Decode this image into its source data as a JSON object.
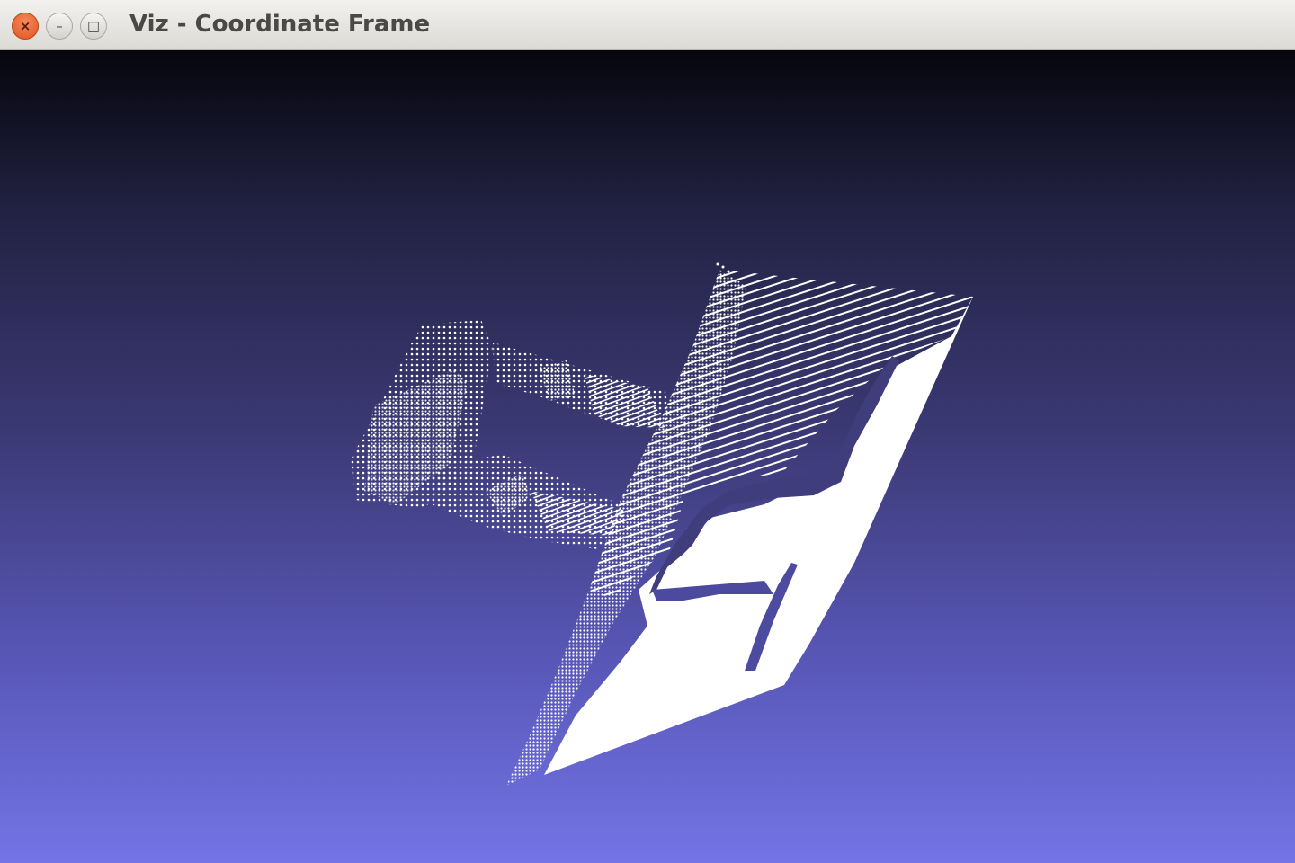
{
  "window": {
    "title": "Viz - Coordinate Frame",
    "buttons": {
      "close_glyph": "×",
      "minimize_glyph": "–",
      "maximize_glyph": "□"
    }
  },
  "viewport": {
    "background_top": "#06060c",
    "background_bottom": "#7474e6",
    "point_color": "#ffffff"
  }
}
